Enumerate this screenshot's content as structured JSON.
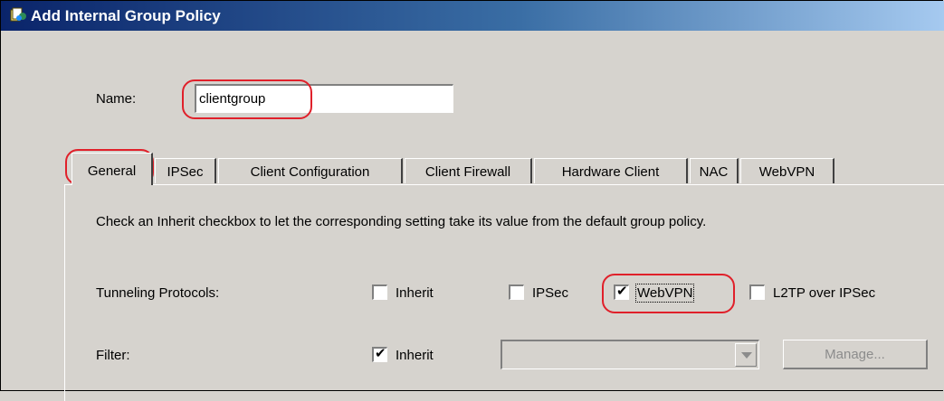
{
  "window": {
    "title": "Add Internal Group Policy",
    "icon": "group-policy-icon"
  },
  "name_field": {
    "label": "Name:",
    "value": "clientgroup"
  },
  "tabs": [
    {
      "label": "General",
      "active": true
    },
    {
      "label": "IPSec"
    },
    {
      "label": "Client Configuration"
    },
    {
      "label": "Client Firewall"
    },
    {
      "label": "Hardware Client"
    },
    {
      "label": "NAC"
    },
    {
      "label": "WebVPN"
    }
  ],
  "general": {
    "instructions": "Check an Inherit checkbox to let the corresponding setting take its value from the default group policy.",
    "tunneling": {
      "label": "Tunneling Protocols:",
      "options": [
        {
          "label": "Inherit",
          "checked": false
        },
        {
          "label": "IPSec",
          "checked": false
        },
        {
          "label": "WebVPN",
          "checked": true
        },
        {
          "label": "L2TP over IPSec",
          "checked": false
        }
      ]
    },
    "filter": {
      "label": "Filter:",
      "inherit": {
        "label": "Inherit",
        "checked": true
      },
      "selected_value": "",
      "manage_label": "Manage..."
    }
  },
  "check_glyph": "✔",
  "colors": {
    "highlight": "#e0202a",
    "title_bar": "#0a246a",
    "background": "#d6d3ce"
  }
}
